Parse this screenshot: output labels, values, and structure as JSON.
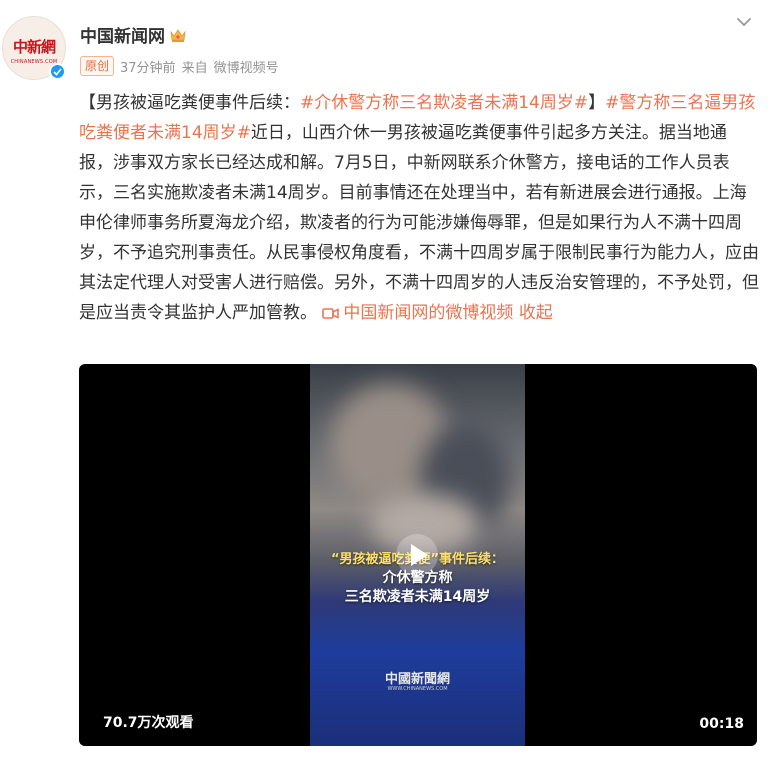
{
  "account": {
    "name": "中国新闻网",
    "avatar_logo": "中新網",
    "avatar_sub": "CHINANEWS.COM",
    "original_badge": "原创",
    "time": "37分钟前",
    "source_prefix": "来自",
    "source": "微博视频号"
  },
  "post": {
    "bracket_open": "【",
    "title": "男孩被逼吃粪便事件后续：",
    "hashtag1": "#介休警方称三名欺凌者未满14周岁#",
    "bracket_close": "】",
    "hashtag2": "#警方称三名逼男孩吃粪便者未满14周岁#",
    "body": "近日，山西介休一男孩被逼吃粪便事件引起多方关注。据当地通报，涉事双方家长已经达成和解。7月5日，中新网联系介休警方，接电话的工作人员表示，三名实施欺凌者未满14周岁。目前事情还在处理当中，若有新进展会进行通报。上海申伦律师事务所夏海龙介绍，欺凌者的行为可能涉嫌侮辱罪，但是如果行为人不满十四周岁，不予追究刑事责任。从民事侵权角度看，不满十四周岁属于限制民事行为能力人，应由其法定代理人对受害人进行赔偿。另外，不满十四周岁的人违反治安管理的，不予处罚，但是应当责令其监护人严加管教。",
    "video_link": "中国新闻网的微博视频",
    "collapse": "收起"
  },
  "video": {
    "overlay_line1": "“男孩被逼吃粪便”事件后续：",
    "overlay_line2": "介休警方称",
    "overlay_line3": "三名欺凌者未满14周岁",
    "logo": "中國新聞網",
    "logo_sub": "WWW.CHINANEWS.COM",
    "views": "70.7万次观看",
    "duration": "00:18"
  },
  "colors": {
    "link": "#eb7350",
    "verified": "#1d9bf0",
    "meta": "#939393"
  }
}
